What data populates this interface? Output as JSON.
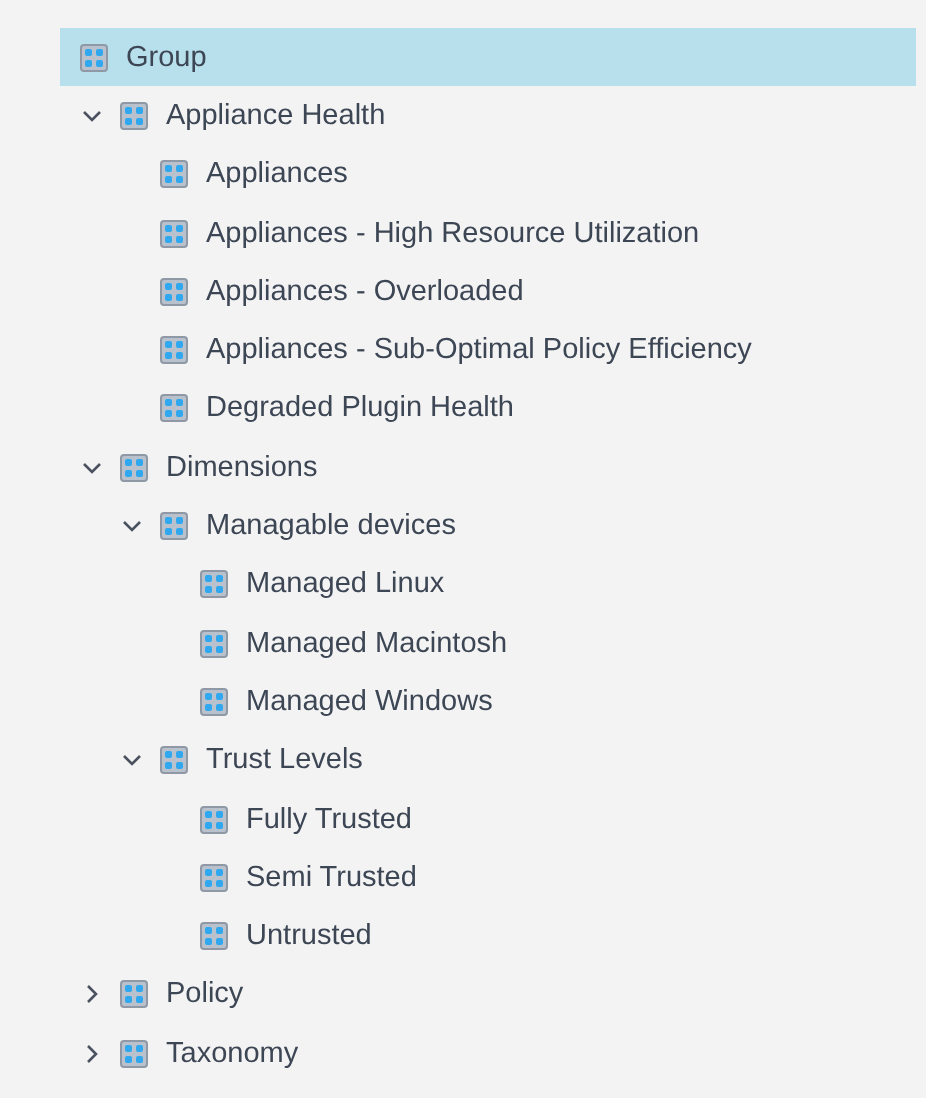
{
  "root": {
    "label": "Group",
    "selected": true
  },
  "items": [
    {
      "label": "Appliance Health",
      "expanded": true,
      "children": [
        {
          "label": "Appliances"
        },
        {
          "label": "Appliances - High Resource Utilization"
        },
        {
          "label": "Appliances - Overloaded"
        },
        {
          "label": "Appliances - Sub-Optimal Policy Efficiency"
        },
        {
          "label": "Degraded Plugin Health"
        }
      ]
    },
    {
      "label": "Dimensions",
      "expanded": true,
      "children": [
        {
          "label": "Managable devices",
          "expanded": true,
          "children": [
            {
              "label": "Managed Linux"
            },
            {
              "label": "Managed Macintosh"
            },
            {
              "label": "Managed Windows"
            }
          ]
        },
        {
          "label": "Trust Levels",
          "expanded": true,
          "children": [
            {
              "label": "Fully Trusted"
            },
            {
              "label": "Semi Trusted"
            },
            {
              "label": "Untrusted"
            }
          ]
        }
      ]
    },
    {
      "label": "Policy",
      "expanded": false
    },
    {
      "label": "Taxonomy",
      "expanded": false
    }
  ]
}
